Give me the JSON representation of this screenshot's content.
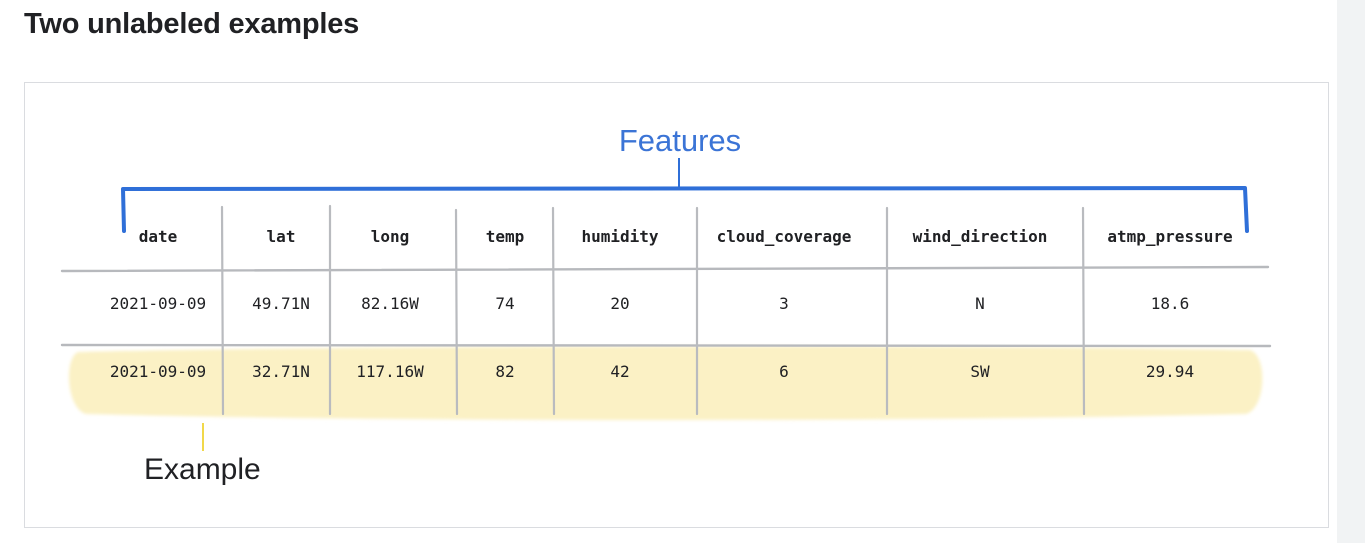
{
  "page": {
    "title": "Two unlabeled examples"
  },
  "diagram": {
    "features_label": "Features",
    "example_label": "Example",
    "brace_color": "#2f6fd8",
    "highlight_color": "#fbf1c5",
    "columns": [
      "date",
      "lat",
      "long",
      "temp",
      "humidity",
      "cloud_coverage",
      "wind_direction",
      "atmp_pressure"
    ],
    "rows": [
      [
        "2021-09-09",
        "49.71N",
        "82.16W",
        "74",
        "20",
        "3",
        "N",
        "18.6"
      ],
      [
        "2021-09-09",
        "32.71N",
        "117.16W",
        "82",
        "42",
        "6",
        "SW",
        "29.94"
      ]
    ],
    "highlighted_row": 1
  }
}
